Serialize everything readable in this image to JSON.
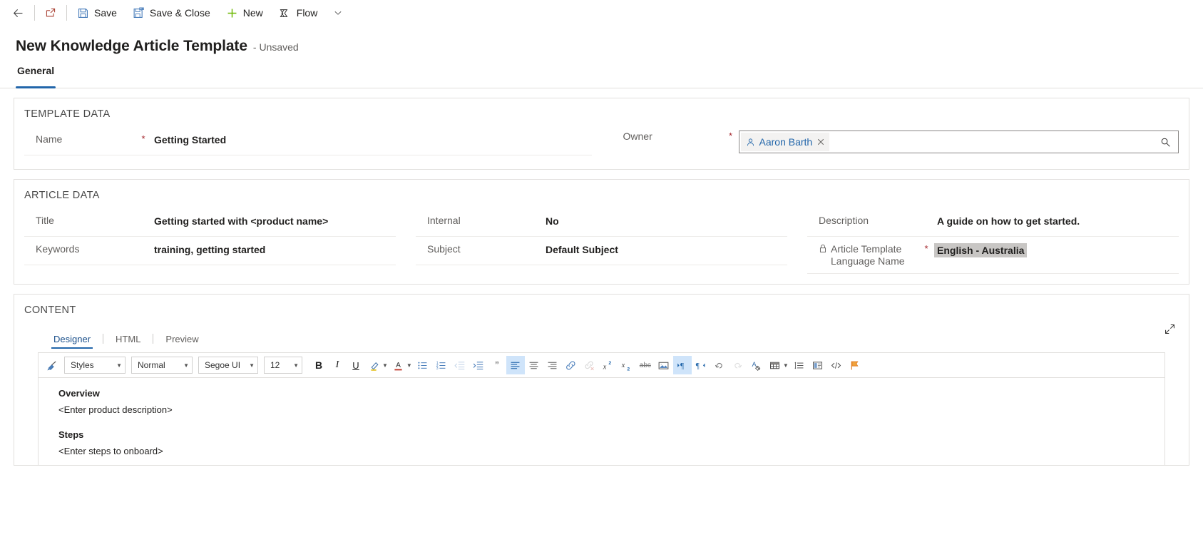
{
  "commandbar": {
    "items": [
      {
        "name": "back",
        "icon": "back-arrow-icon",
        "label": ""
      },
      {
        "name": "open-new-window",
        "icon": "open-in-new-window-icon",
        "label": ""
      },
      {
        "name": "save",
        "icon": "save-icon",
        "label": "Save"
      },
      {
        "name": "save-and-close",
        "icon": "save-and-close-icon",
        "label": "Save & Close"
      },
      {
        "name": "new",
        "icon": "plus-icon",
        "label": "New"
      },
      {
        "name": "flow",
        "icon": "flow-icon",
        "label": "Flow"
      },
      {
        "name": "overflow",
        "icon": "chevron-down-icon",
        "label": ""
      }
    ]
  },
  "header": {
    "title": "New Knowledge Article Template",
    "state": "- Unsaved"
  },
  "tabs": [
    {
      "label": "General",
      "active": true
    }
  ],
  "template_data": {
    "section_title": "TEMPLATE DATA",
    "name": {
      "label": "Name",
      "required": "*",
      "value": "Getting Started"
    },
    "owner": {
      "label": "Owner",
      "required": "*",
      "value": "Aaron Barth",
      "person_icon": "person-icon",
      "clear_icon": "close-icon",
      "search_icon": "search-icon"
    }
  },
  "article_data": {
    "section_title": "ARTICLE DATA",
    "col1": [
      {
        "label": "Title",
        "required": "",
        "value": "Getting started with <product name>"
      },
      {
        "label": "Keywords",
        "required": "",
        "value": "training, getting started"
      }
    ],
    "col2": [
      {
        "label": "Internal",
        "required": "",
        "value": "No"
      },
      {
        "label": "Subject",
        "required": "",
        "value": "Default Subject"
      }
    ],
    "col3": [
      {
        "label": "Description",
        "required": "",
        "value": "A guide on how to get started."
      },
      {
        "label": "Article Template Language Name",
        "required": "*",
        "value": "English - Australia",
        "locked": true,
        "lock_icon": "lock-icon",
        "selected": true
      }
    ]
  },
  "content": {
    "section_title": "CONTENT",
    "expand_icon": "expand-diagonal-icon",
    "subtabs": [
      {
        "label": "Designer",
        "active": true
      },
      {
        "label": "HTML",
        "active": false
      },
      {
        "label": "Preview",
        "active": false
      }
    ],
    "toolbar": {
      "format_painter": "format-painter-icon",
      "styles": "Styles",
      "paragraph_format": "Normal",
      "font_family": "Segoe UI",
      "font_size": "12",
      "buttons": [
        {
          "name": "bold-button",
          "glyph": "B"
        },
        {
          "name": "italic-button",
          "glyph": "I"
        },
        {
          "name": "underline-button",
          "glyph": "U"
        },
        {
          "name": "highlight-color-button",
          "glyph": ""
        },
        {
          "name": "font-color-button",
          "glyph": "A"
        },
        {
          "name": "bulleted-list-button",
          "glyph": ""
        },
        {
          "name": "numbered-list-button",
          "glyph": ""
        },
        {
          "name": "decrease-indent-button",
          "glyph": ""
        },
        {
          "name": "increase-indent-button",
          "glyph": ""
        },
        {
          "name": "blockquote-button",
          "glyph": "”"
        },
        {
          "name": "align-left-button",
          "glyph": ""
        },
        {
          "name": "align-center-button",
          "glyph": ""
        },
        {
          "name": "align-right-button",
          "glyph": ""
        },
        {
          "name": "insert-link-button",
          "glyph": ""
        },
        {
          "name": "remove-link-button",
          "glyph": ""
        },
        {
          "name": "superscript-button",
          "glyph": "x"
        },
        {
          "name": "subscript-button",
          "glyph": "x"
        },
        {
          "name": "strikethrough-button",
          "glyph": "abc"
        },
        {
          "name": "insert-image-button",
          "glyph": ""
        },
        {
          "name": "left-to-right-button",
          "glyph": ""
        },
        {
          "name": "right-to-left-button",
          "glyph": ""
        },
        {
          "name": "undo-button",
          "glyph": ""
        },
        {
          "name": "redo-button",
          "glyph": ""
        },
        {
          "name": "clear-formatting-button",
          "glyph": ""
        },
        {
          "name": "insert-table-button",
          "glyph": ""
        },
        {
          "name": "line-spacing-button",
          "glyph": ""
        },
        {
          "name": "insert-template-button",
          "glyph": ""
        },
        {
          "name": "source-code-button",
          "glyph": ""
        },
        {
          "name": "flag-button",
          "glyph": ""
        }
      ]
    },
    "document": {
      "heading1": "Overview",
      "para1": "<Enter product description>",
      "heading2": "Steps",
      "para2": "<Enter steps to onboard>"
    }
  },
  "colors": {
    "accent": "#2266aa",
    "required": "#a4262c",
    "link": "#2266aa",
    "toolbar_active": "#cfe4fa",
    "selection": "#c8c6c4",
    "new_green": "#6bb700"
  }
}
